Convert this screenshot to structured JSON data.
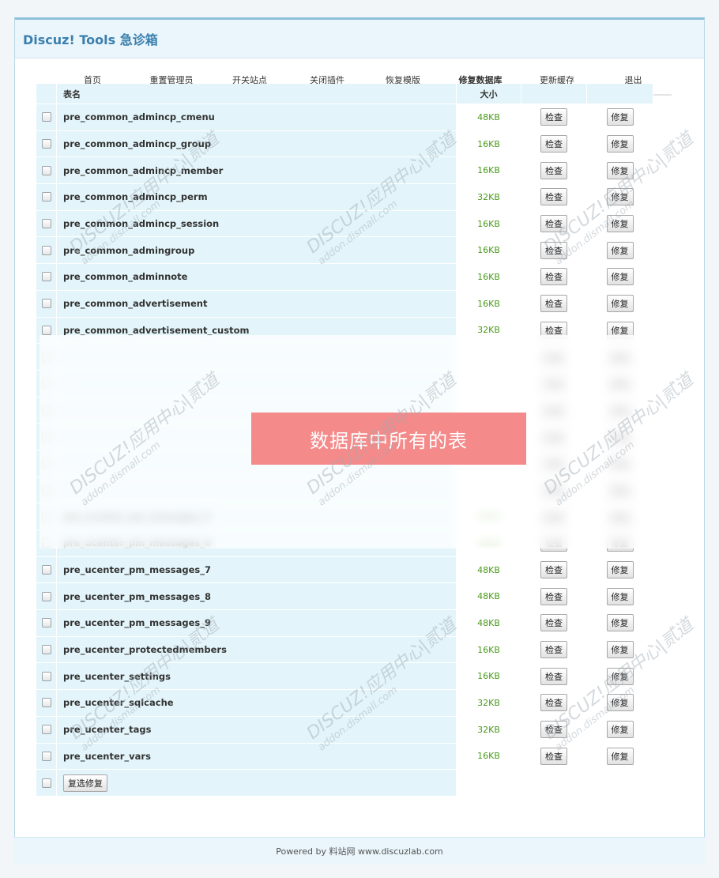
{
  "app": {
    "title": "Discuz! Tools 急诊箱"
  },
  "nav": {
    "tabs": [
      {
        "label": "首页",
        "active": false
      },
      {
        "label": "重置管理员",
        "active": false
      },
      {
        "label": "开关站点",
        "active": false
      },
      {
        "label": "关闭插件",
        "active": false
      },
      {
        "label": "恢复模版",
        "active": false
      },
      {
        "label": "修复数据库",
        "active": true
      },
      {
        "label": "更新缓存",
        "active": false
      },
      {
        "label": "退出",
        "active": false
      }
    ]
  },
  "table": {
    "headers": {
      "name": "表名",
      "size": "大小"
    },
    "check_label": "检查",
    "repair_label": "修复",
    "rows": [
      {
        "name": "pre_common_admincp_cmenu",
        "size": "48KB"
      },
      {
        "name": "pre_common_admincp_group",
        "size": "16KB"
      },
      {
        "name": "pre_common_admincp_member",
        "size": "16KB"
      },
      {
        "name": "pre_common_admincp_perm",
        "size": "32KB"
      },
      {
        "name": "pre_common_admincp_session",
        "size": "16KB"
      },
      {
        "name": "pre_common_admingroup",
        "size": "16KB"
      },
      {
        "name": "pre_common_adminnote",
        "size": "16KB"
      },
      {
        "name": "pre_common_advertisement",
        "size": "16KB"
      },
      {
        "name": "pre_common_advertisement_custom",
        "size": "32KB"
      },
      {
        "name": "",
        "size": ""
      },
      {
        "name": "",
        "size": ""
      },
      {
        "name": "",
        "size": ""
      },
      {
        "name": "",
        "size": ""
      },
      {
        "name": "",
        "size": ""
      },
      {
        "name": "",
        "size": ""
      },
      {
        "name": "pre_ucenter_pm_messages_5",
        "size": "48KB"
      },
      {
        "name": "pre_ucenter_pm_messages_6",
        "size": "48KB"
      },
      {
        "name": "pre_ucenter_pm_messages_7",
        "size": "48KB"
      },
      {
        "name": "pre_ucenter_pm_messages_8",
        "size": "48KB"
      },
      {
        "name": "pre_ucenter_pm_messages_9",
        "size": "48KB"
      },
      {
        "name": "pre_ucenter_protectedmembers",
        "size": "16KB"
      },
      {
        "name": "pre_ucenter_settings",
        "size": "16KB"
      },
      {
        "name": "pre_ucenter_sqlcache",
        "size": "32KB"
      },
      {
        "name": "pre_ucenter_tags",
        "size": "32KB"
      },
      {
        "name": "pre_ucenter_vars",
        "size": "16KB"
      }
    ],
    "batch_repair_label": "复选修复"
  },
  "overlay": {
    "text": "数据库中所有的表"
  },
  "watermark": {
    "line1": "DISCUZ!应用中心|贰道",
    "line2": "addon.dismall.com"
  },
  "footer": {
    "text": "Powered by 料站网 www.discuzlab.com"
  },
  "colors": {
    "accent": "#f3a23b",
    "title": "#3b7fae",
    "size_text": "#4a9a1a",
    "row_bg": "#e3f5fa",
    "banner": "#f48a8a"
  }
}
